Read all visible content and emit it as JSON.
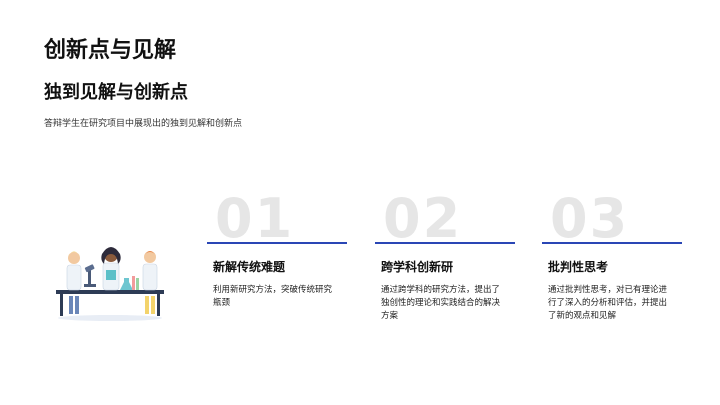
{
  "slide": {
    "title": "创新点与见解",
    "heading": "独到见解与创新点",
    "description": "答辩学生在研究项目中展现出的独到见解和创新点"
  },
  "cards": [
    {
      "number": "01",
      "title": "新解传统难题",
      "body": "利用新研究方法，突破传统研究瓶颈"
    },
    {
      "number": "02",
      "title": "跨学科创新研",
      "body": "通过跨学科的研究方法，提出了独创性的理论和实践结合的解决方案"
    },
    {
      "number": "03",
      "title": "批判性思考",
      "body": "通过批判性思考，对已有理论进行了深入的分析和评估，并提出了新的观点和见解"
    }
  ],
  "colors": {
    "accent": "#2a46b5",
    "number": "#e6e6e6"
  },
  "illustration": {
    "icon": "scientists-lab-illustration"
  }
}
